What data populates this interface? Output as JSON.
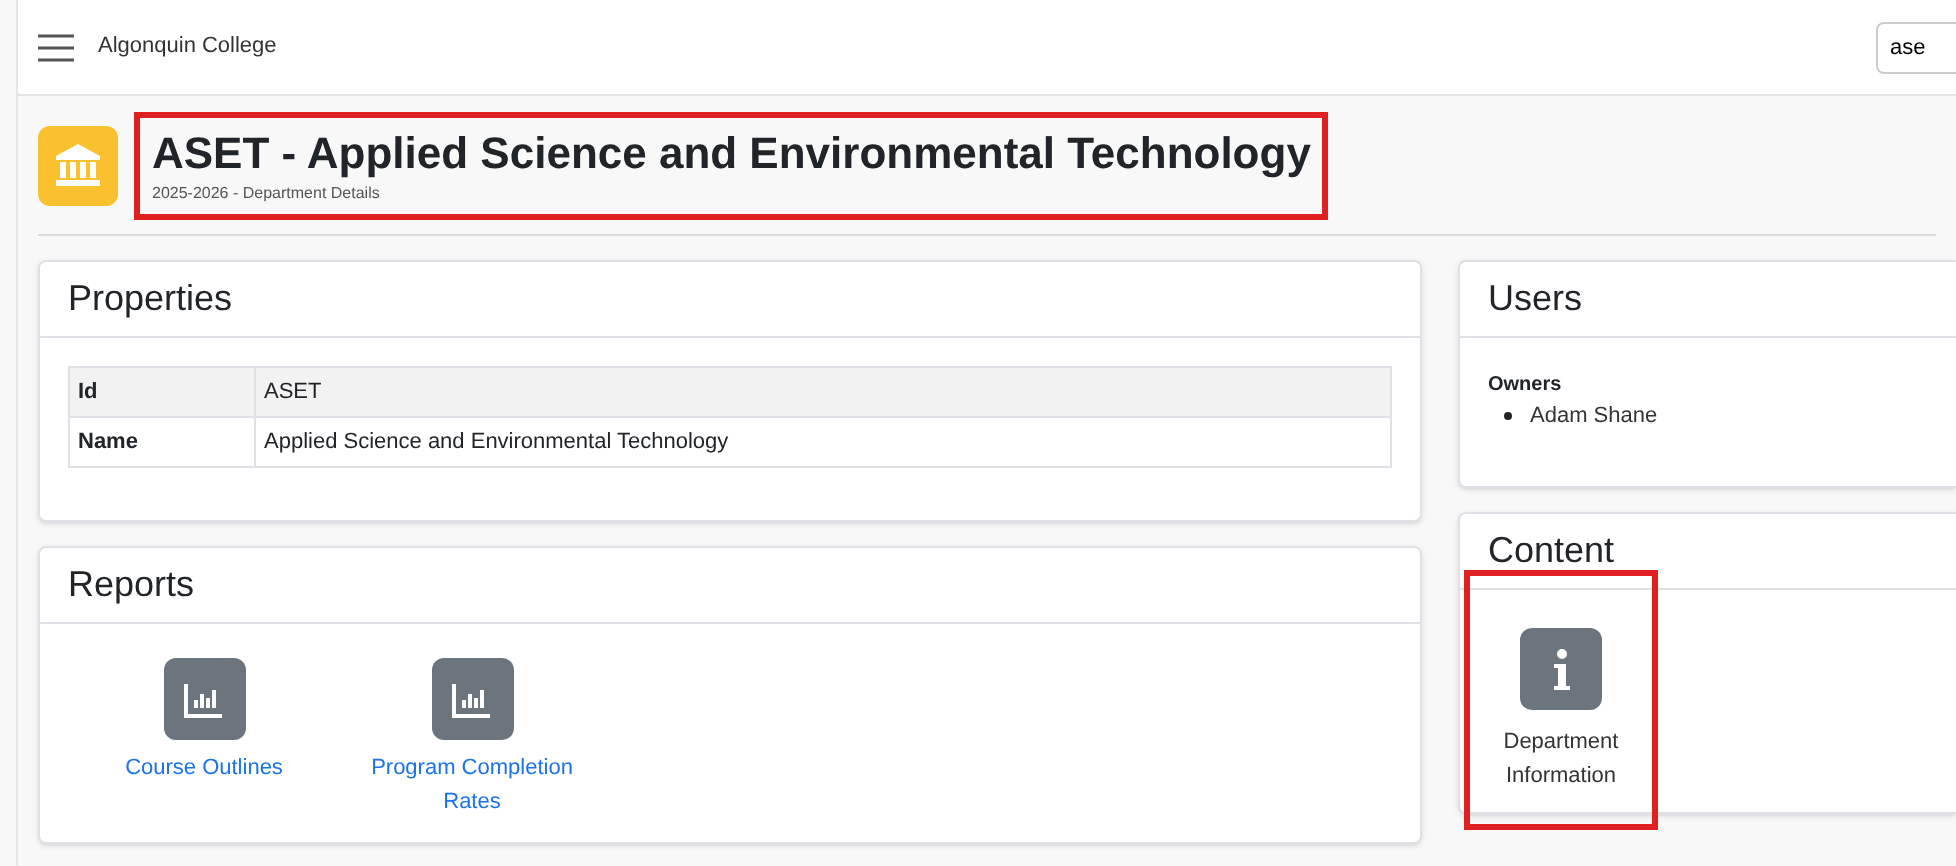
{
  "topbar": {
    "brand": "Algonquin College",
    "search": {
      "value": "ase"
    }
  },
  "header": {
    "title": "ASET - Applied Science and Environmental Technology",
    "subtitle": "2025-2026 - Department Details",
    "highlighted": true
  },
  "properties": {
    "title": "Properties",
    "rows": [
      {
        "label": "Id",
        "value": "ASET"
      },
      {
        "label": "Name",
        "value": "Applied Science and Environmental Technology"
      }
    ]
  },
  "reports": {
    "title": "Reports",
    "items": [
      {
        "label": "Course Outlines"
      },
      {
        "label": "Program Completion Rates"
      }
    ]
  },
  "users": {
    "title": "Users",
    "groups": [
      {
        "label": "Owners",
        "members": [
          "Adam Shane"
        ]
      }
    ]
  },
  "content": {
    "title": "Content",
    "items": [
      {
        "label": "Department Information",
        "highlighted": true
      }
    ]
  }
}
